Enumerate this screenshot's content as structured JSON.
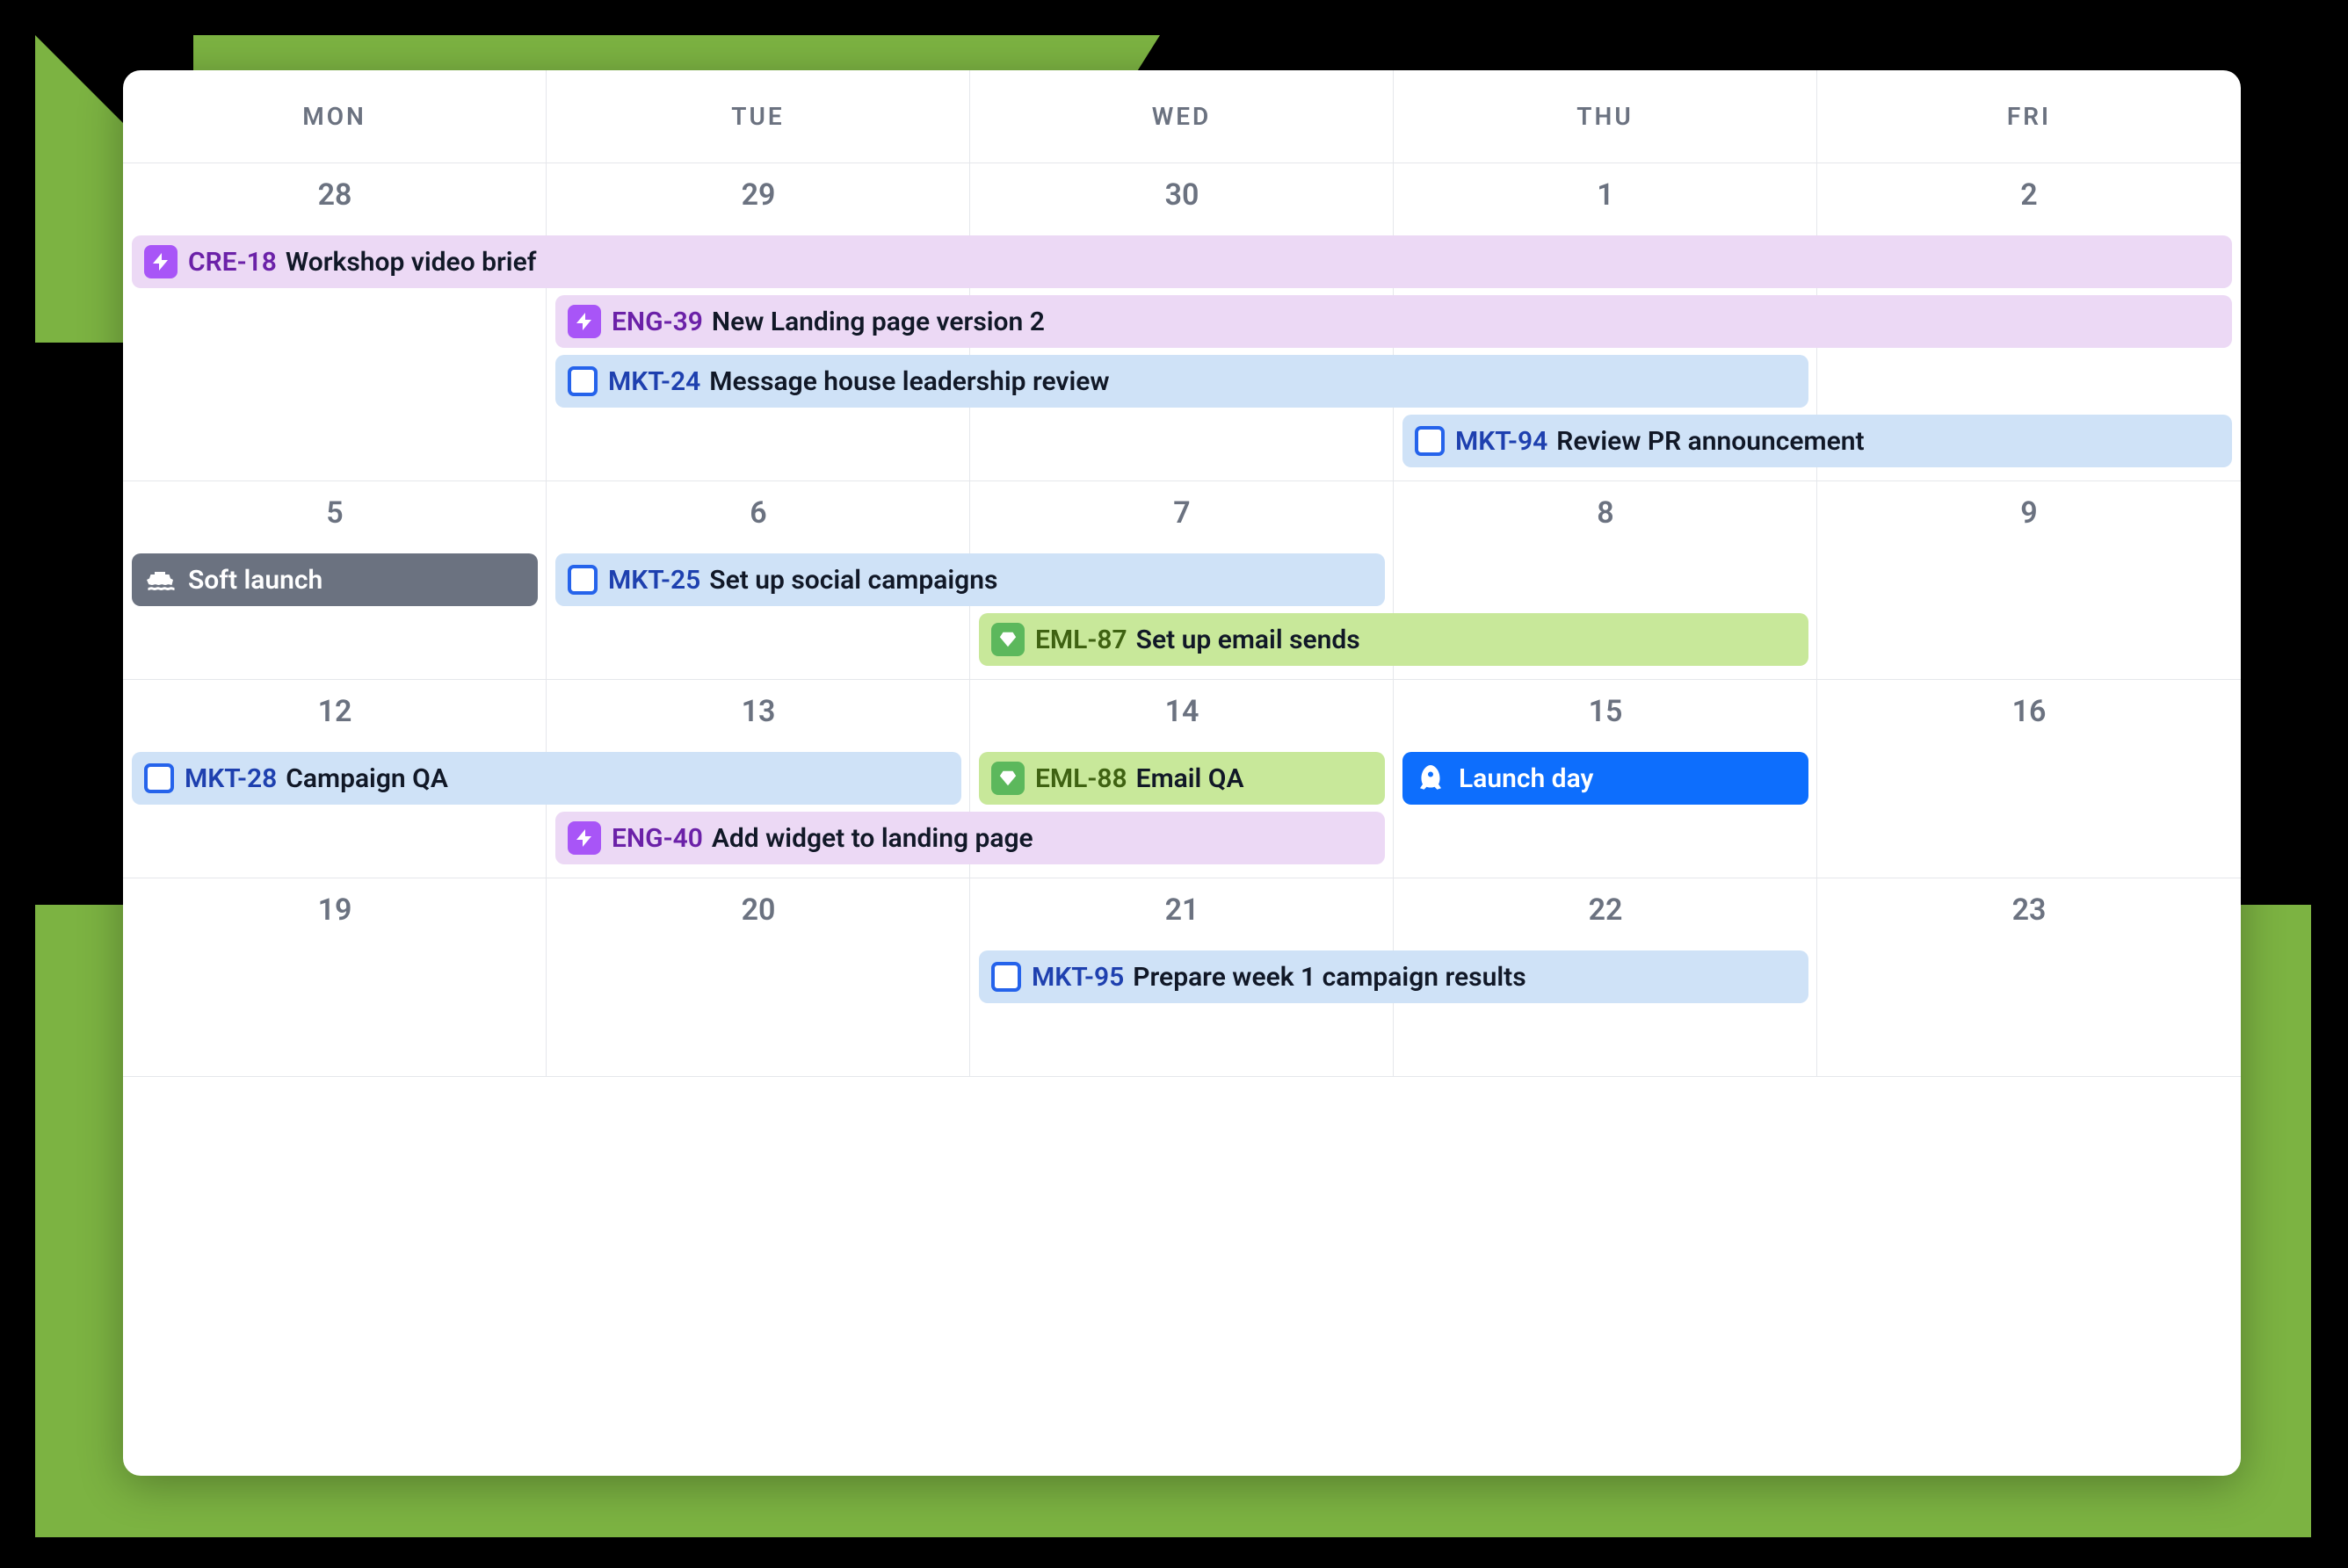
{
  "days": [
    "MON",
    "TUE",
    "WED",
    "THU",
    "FRI"
  ],
  "weeks": [
    {
      "dates": [
        "28",
        "29",
        "30",
        "1",
        "2"
      ],
      "events": [
        {
          "id": "CRE-18",
          "title": "Workshop video brief",
          "type": "purple",
          "start": 0,
          "span": 5,
          "icon": "lightning"
        },
        {
          "id": "ENG-39",
          "title": "New Landing page version 2",
          "type": "purple",
          "start": 1,
          "span": 4,
          "icon": "lightning"
        },
        {
          "id": "MKT-24",
          "title": "Message house leadership review",
          "type": "blue",
          "start": 1,
          "span": 3,
          "icon": "square"
        },
        {
          "id": "MKT-94",
          "title": "Review PR announcement",
          "type": "blue",
          "start": 3,
          "span": 2,
          "icon": "square"
        }
      ]
    },
    {
      "dates": [
        "5",
        "6",
        "7",
        "8",
        "9"
      ],
      "events": [
        {
          "id": "",
          "title": "Soft launch",
          "type": "grey",
          "start": 0,
          "span": 1,
          "icon": "ship"
        },
        {
          "id": "MKT-25",
          "title": "Set up social campaigns",
          "type": "blue",
          "start": 1,
          "span": 2,
          "icon": "square",
          "row": 0
        },
        {
          "id": "EML-87",
          "title": "Set up email sends",
          "type": "green",
          "start": 2,
          "span": 2,
          "icon": "diamond"
        }
      ]
    },
    {
      "dates": [
        "12",
        "13",
        "14",
        "15",
        "16"
      ],
      "events": [
        {
          "id": "MKT-28",
          "title": "Campaign QA",
          "type": "blue",
          "start": 0,
          "span": 2,
          "icon": "square"
        },
        {
          "id": "",
          "title": "Launch day",
          "type": "darkblue",
          "start": 3,
          "span": 1,
          "icon": "rocket",
          "row": 0
        },
        {
          "id": "ENG-40",
          "title": "Add widget to landing page",
          "type": "purple",
          "start": 1,
          "span": 2,
          "icon": "lightning"
        },
        {
          "id": "EML-88",
          "title": "Email QA",
          "type": "green",
          "start": 2,
          "span": 1,
          "icon": "diamond"
        }
      ]
    },
    {
      "dates": [
        "19",
        "20",
        "21",
        "22",
        "23"
      ],
      "events": [
        {
          "id": "MKT-95",
          "title": "Prepare week 1 campaign results",
          "type": "blue",
          "start": 2,
          "span": 2,
          "icon": "square"
        }
      ]
    }
  ]
}
